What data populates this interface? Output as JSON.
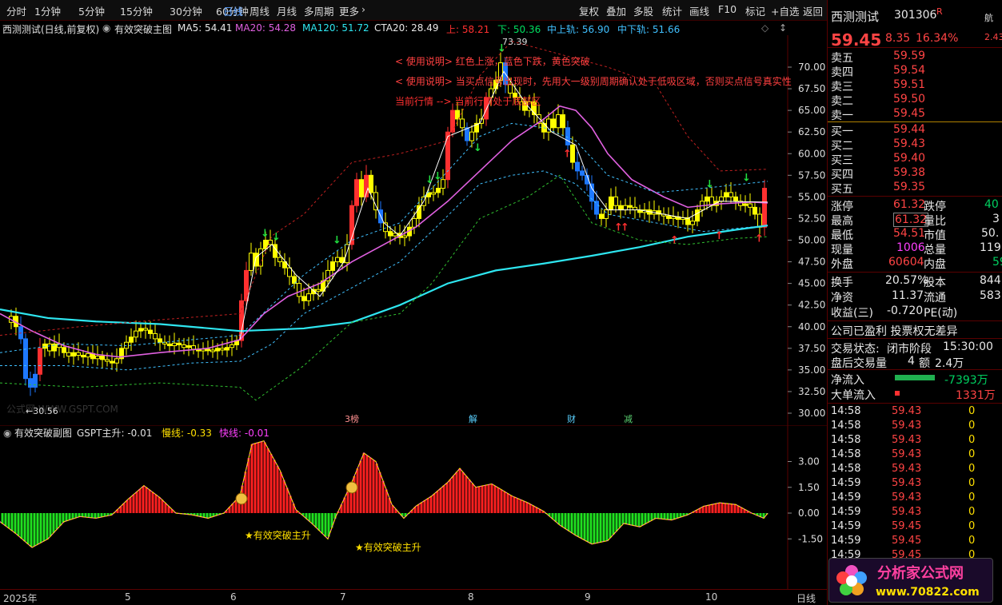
{
  "topbar": {
    "periods": [
      "分时",
      "1分钟",
      "5分钟",
      "15分钟",
      "30分钟",
      "60分钟",
      "日线",
      "周线",
      "月线",
      "多周期",
      "更多"
    ],
    "active": "日线",
    "tools": [
      "复权",
      "叠加",
      "多股",
      "统计",
      "画线",
      "F10",
      "标记",
      "+自选",
      "返回"
    ]
  },
  "info": {
    "stock": "西测测试(日线,前复权)",
    "indicator": "有效突破主图",
    "ma5": "MA5: 54.41",
    "ma20": "MA20: 54.28",
    "ma120": "MA120: 51.72",
    "cta20": "CTA20: 28.49",
    "up": "上: 58.21",
    "down": "下: 50.36",
    "mid_up": "中上轨: 56.90",
    "mid_down": "中下轨: 51.66"
  },
  "chart_text": {
    "note1": "< 使用说明> 红色上涨，蓝色下跌，黄色突破",
    "note2": "< 使用说明> 当买点信号出现时，先用大一级别周期确认处于低吸区域，否则买点信号真实性",
    "note3": "当前行情 --> 当前行情处于底部区",
    "high_label": "73.39",
    "low_label": "←30.56",
    "watermark": "公式网 WWW.GSPT.COM",
    "flags": [
      "3榜",
      "解",
      "财",
      "减"
    ]
  },
  "chart_data": {
    "type": "line",
    "y_ticks_main": [
      70.0,
      67.5,
      65.0,
      62.5,
      60.0,
      57.5,
      55.0,
      52.5,
      50.0,
      47.5,
      45.0,
      42.5,
      40.0,
      37.5,
      35.0,
      32.5,
      30.0
    ],
    "y_ticks_sub": [
      3.0,
      1.5,
      0.0,
      -1.5
    ],
    "x_labels": [
      "2025年",
      "5",
      "6",
      "7",
      "8",
      "9",
      "10"
    ],
    "sub_indicator": {
      "title": "有效突破副图",
      "gspt": "GSPT主升: -0.01",
      "slow": "慢线: -0.33",
      "fast": "快线: -0.01",
      "signal_label": "★有效突破主升"
    },
    "period_label": "日线"
  },
  "quote": {
    "name": "西测测试",
    "code": "301306",
    "badge": "R",
    "corner": "航",
    "corner2": "2.43",
    "price": "59.45",
    "change": "8.35",
    "pct": "16.34%",
    "asks": [
      {
        "label": "卖五",
        "price": "59.59"
      },
      {
        "label": "卖四",
        "price": "59.54"
      },
      {
        "label": "卖三",
        "price": "59.51"
      },
      {
        "label": "卖二",
        "price": "59.50"
      },
      {
        "label": "卖一",
        "price": "59.45"
      }
    ],
    "bids": [
      {
        "label": "买一",
        "price": "59.44"
      },
      {
        "label": "买二",
        "price": "59.43"
      },
      {
        "label": "买三",
        "price": "59.40"
      },
      {
        "label": "买四",
        "price": "59.38"
      },
      {
        "label": "买五",
        "price": "59.35"
      }
    ],
    "stats": [
      {
        "l1": "涨停",
        "v1": "61.32",
        "l2": "跌停",
        "v2": "40"
      },
      {
        "l1": "最高",
        "v1": "61.32",
        "l2": "量比",
        "v2": "3"
      },
      {
        "l1": "最低",
        "v1": "54.51",
        "l2": "市值",
        "v2": "50."
      },
      {
        "l1": "现量",
        "v1": "1006",
        "l2": "总量",
        "v2": "119"
      },
      {
        "l1": "外盘",
        "v1": "60604",
        "l2": "内盘",
        "v2": "59"
      }
    ],
    "stats2": [
      {
        "l1": "换手",
        "v1": "20.57%",
        "l2": "股本",
        "v2": "844"
      },
      {
        "l1": "净资",
        "v1": "11.37",
        "l2": "流通",
        "v2": "583"
      },
      {
        "l1": "收益(三)",
        "v1": "-0.720",
        "l2": "PE(动)",
        "v2": ""
      }
    ],
    "profit_line": "公司已盈利 投票权无差异",
    "trade_status_label": "交易状态:",
    "trade_status": "闭市阶段",
    "trade_time": "15:30:00",
    "after_label": "盘后交易量",
    "after_vol": "4",
    "after_amt_label": "额",
    "after_amt": "2.4万",
    "netflow_label": "净流入",
    "netflow": "-7393万",
    "bigflow_label": "大单流入",
    "bigflow": "1331万",
    "ticks": [
      {
        "time": "14:58",
        "price": "59.43",
        "vol": "0"
      },
      {
        "time": "14:58",
        "price": "59.43",
        "vol": "0"
      },
      {
        "time": "14:58",
        "price": "59.43",
        "vol": "0"
      },
      {
        "time": "14:58",
        "price": "59.43",
        "vol": "0"
      },
      {
        "time": "14:58",
        "price": "59.43",
        "vol": "0"
      },
      {
        "time": "14:59",
        "price": "59.43",
        "vol": "0"
      },
      {
        "time": "14:59",
        "price": "59.43",
        "vol": "0"
      },
      {
        "time": "14:59",
        "price": "59.43",
        "vol": "0"
      },
      {
        "time": "14:59",
        "price": "59.45",
        "vol": "0"
      },
      {
        "time": "14:59",
        "price": "59.45",
        "vol": "0"
      },
      {
        "time": "14:59",
        "price": "59.45",
        "vol": "0"
      }
    ]
  },
  "logo": {
    "title": "分析家公式网",
    "url": "www.70822.com"
  },
  "colors": {
    "up": "#ff3030",
    "down": "#1e78ff",
    "breakout": "#ffff00",
    "ma120": "#2ee6f0",
    "ma20": "#e060e0",
    "grid": "#5a0000"
  }
}
